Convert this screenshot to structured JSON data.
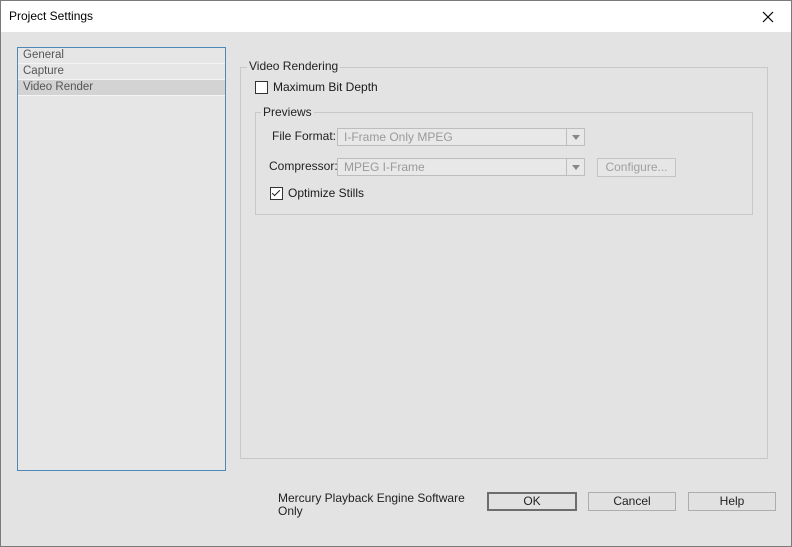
{
  "window": {
    "title": "Project Settings",
    "close_glyph": "✕"
  },
  "sidebar": {
    "items": [
      {
        "label": "General",
        "selected": false
      },
      {
        "label": "Capture",
        "selected": false
      },
      {
        "label": "Video Render",
        "selected": true
      }
    ]
  },
  "video_rendering": {
    "legend": "Video Rendering",
    "max_bit_depth": {
      "label": "Maximum Bit Depth",
      "checked": false
    }
  },
  "previews": {
    "legend": "Previews",
    "file_format": {
      "label": "File Format:",
      "value": "I-Frame Only MPEG"
    },
    "compressor": {
      "label": "Compressor:",
      "value": "MPEG I-Frame"
    },
    "configure_label": "Configure...",
    "optimize_stills": {
      "label": "Optimize Stills",
      "checked": true
    }
  },
  "footer": {
    "engine_text": "Mercury Playback Engine Software Only",
    "ok_label": "OK",
    "cancel_label": "Cancel",
    "help_label": "Help"
  }
}
